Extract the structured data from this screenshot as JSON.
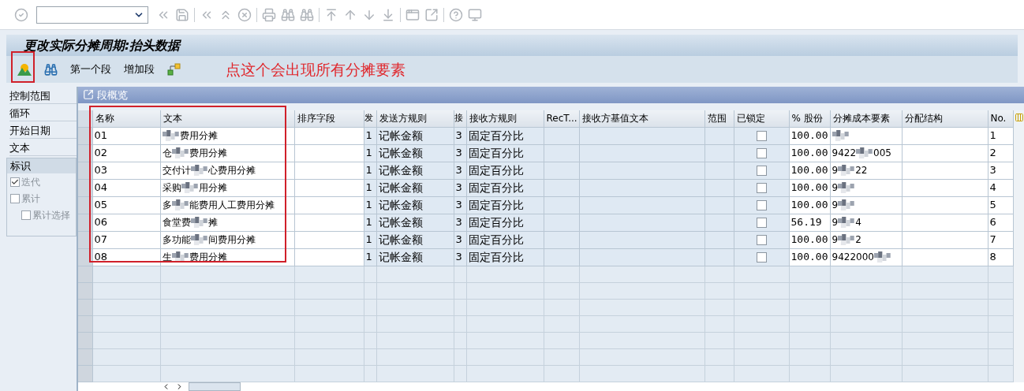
{
  "title": "更改实际分摊周期:抬头数据",
  "app_toolbar": [
    {
      "kind": "icon"
    },
    {
      "kind": "icon"
    },
    {
      "kind": "text",
      "label": "第一个段"
    },
    {
      "kind": "text",
      "label": "增加段"
    },
    {
      "kind": "icon"
    }
  ],
  "annotation": "点这个会出现所有分摊要素",
  "sidebar": {
    "items": [
      "控制范围",
      "循环",
      "开始日期",
      "文本"
    ],
    "group": {
      "title": "标识",
      "options": [
        {
          "label": "迭代",
          "checked": true
        },
        {
          "label": "累计",
          "checked": false,
          "children": [
            {
              "label": "累计选择",
              "checked": false
            }
          ]
        }
      ]
    }
  },
  "panel": {
    "title": "段概览",
    "columns": [
      "名称",
      "文本",
      "排序字段",
      "发",
      "发送方规则",
      "接",
      "接收方规则",
      "RecT...",
      "接收方基值文本",
      "范围",
      "已锁定",
      "% 股份",
      "分摊成本要素",
      "分配结构",
      "No."
    ],
    "rows": [
      {
        "name": "01",
        "text": [
          {
            "kind": "redacted"
          },
          {
            "kind": "text",
            "text": "费用分摊"
          }
        ],
        "sender_flag": "1",
        "sender_rule": "记帐金额",
        "receiver_flag": "3",
        "receiver_rule": "固定百分比",
        "locked": false,
        "share": "100.00",
        "cost_element": [
          {
            "kind": "redacted"
          }
        ],
        "no": "1"
      },
      {
        "name": "02",
        "text": [
          {
            "kind": "text",
            "text": "仓"
          },
          {
            "kind": "redacted"
          },
          {
            "kind": "text",
            "text": "费用分摊"
          }
        ],
        "sender_flag": "1",
        "sender_rule": "记帐金额",
        "receiver_flag": "3",
        "receiver_rule": "固定百分比",
        "locked": false,
        "share": "100.00",
        "cost_element": [
          {
            "kind": "text",
            "text": "9422"
          },
          {
            "kind": "redacted"
          },
          {
            "kind": "text",
            "text": "005"
          }
        ],
        "no": "2"
      },
      {
        "name": "03",
        "text": [
          {
            "kind": "text",
            "text": "交付计"
          },
          {
            "kind": "redacted"
          },
          {
            "kind": "text",
            "text": "心费用分摊"
          }
        ],
        "sender_flag": "1",
        "sender_rule": "记帐金额",
        "receiver_flag": "3",
        "receiver_rule": "固定百分比",
        "locked": false,
        "share": "100.00",
        "cost_element": [
          {
            "kind": "text",
            "text": "9"
          },
          {
            "kind": "redacted"
          },
          {
            "kind": "text",
            "text": "22"
          }
        ],
        "no": "3"
      },
      {
        "name": "04",
        "text": [
          {
            "kind": "text",
            "text": "采购"
          },
          {
            "kind": "redacted"
          },
          {
            "kind": "text",
            "text": "用分摊"
          }
        ],
        "sender_flag": "1",
        "sender_rule": "记帐金额",
        "receiver_flag": "3",
        "receiver_rule": "固定百分比",
        "locked": false,
        "share": "100.00",
        "cost_element": [
          {
            "kind": "text",
            "text": "9"
          },
          {
            "kind": "redacted"
          }
        ],
        "no": "4"
      },
      {
        "name": "05",
        "text": [
          {
            "kind": "text",
            "text": "多"
          },
          {
            "kind": "redacted"
          },
          {
            "kind": "text",
            "text": "能费用人工费用分摊"
          }
        ],
        "sender_flag": "1",
        "sender_rule": "记帐金额",
        "receiver_flag": "3",
        "receiver_rule": "固定百分比",
        "locked": false,
        "share": "100.00",
        "cost_element": [
          {
            "kind": "text",
            "text": "9"
          },
          {
            "kind": "redacted"
          }
        ],
        "no": "5"
      },
      {
        "name": "06",
        "text": [
          {
            "kind": "text",
            "text": "食堂费"
          },
          {
            "kind": "redacted"
          },
          {
            "kind": "text",
            "text": "摊"
          }
        ],
        "sender_flag": "1",
        "sender_rule": "记帐金额",
        "receiver_flag": "3",
        "receiver_rule": "固定百分比",
        "locked": false,
        "share": "56.19",
        "cost_element": [
          {
            "kind": "text",
            "text": "9"
          },
          {
            "kind": "redacted"
          },
          {
            "kind": "text",
            "text": "4"
          }
        ],
        "no": "6"
      },
      {
        "name": "07",
        "text": [
          {
            "kind": "text",
            "text": "多功能"
          },
          {
            "kind": "redacted"
          },
          {
            "kind": "text",
            "text": "间费用分摊"
          }
        ],
        "sender_flag": "1",
        "sender_rule": "记帐金额",
        "receiver_flag": "3",
        "receiver_rule": "固定百分比",
        "locked": false,
        "share": "100.00",
        "cost_element": [
          {
            "kind": "text",
            "text": "9"
          },
          {
            "kind": "redacted"
          },
          {
            "kind": "text",
            "text": "2"
          }
        ],
        "no": "7"
      },
      {
        "name": "08",
        "text": [
          {
            "kind": "text",
            "text": "生"
          },
          {
            "kind": "redacted"
          },
          {
            "kind": "text",
            "text": "费用分摊"
          }
        ],
        "sender_flag": "1",
        "sender_rule": "记帐金额",
        "receiver_flag": "3",
        "receiver_rule": "固定百分比",
        "locked": false,
        "share": "100.00",
        "cost_element": [
          {
            "kind": "text",
            "text": "9422000"
          },
          {
            "kind": "redacted"
          }
        ],
        "no": "8"
      }
    ]
  }
}
